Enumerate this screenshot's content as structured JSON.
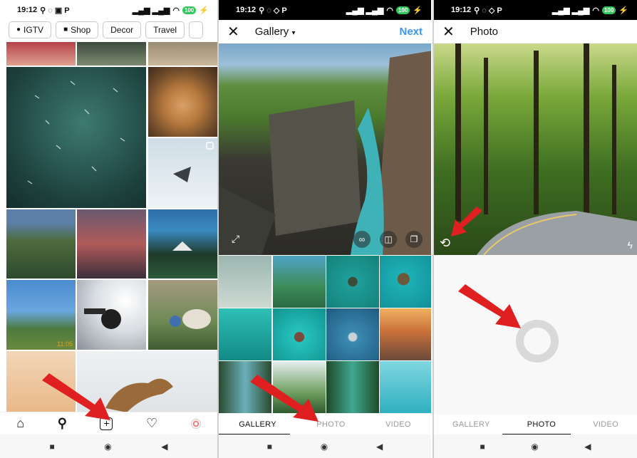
{
  "status": {
    "time": "19:12",
    "battery": "100"
  },
  "panel1": {
    "chips": [
      {
        "label": "IGTV",
        "icon": "tv-icon"
      },
      {
        "label": "Shop",
        "icon": "bag-icon"
      },
      {
        "label": "Decor",
        "icon": ""
      },
      {
        "label": "Travel",
        "icon": ""
      }
    ],
    "video_duration": "11:05",
    "nav": [
      "home-icon",
      "search-icon",
      "add-post-icon",
      "heart-icon",
      "profile-avatar"
    ]
  },
  "panel2": {
    "title": "Gallery",
    "next_label": "Next",
    "tabs": [
      "GALLERY",
      "PHOTO",
      "VIDEO"
    ],
    "active_tab": "GALLERY"
  },
  "panel3": {
    "title": "Photo",
    "tabs": [
      "GALLERY",
      "PHOTO",
      "VIDEO"
    ],
    "active_tab": "PHOTO"
  },
  "colors": {
    "accent": "#3897f0",
    "arrow": "#e02020",
    "battery": "#34c759"
  }
}
